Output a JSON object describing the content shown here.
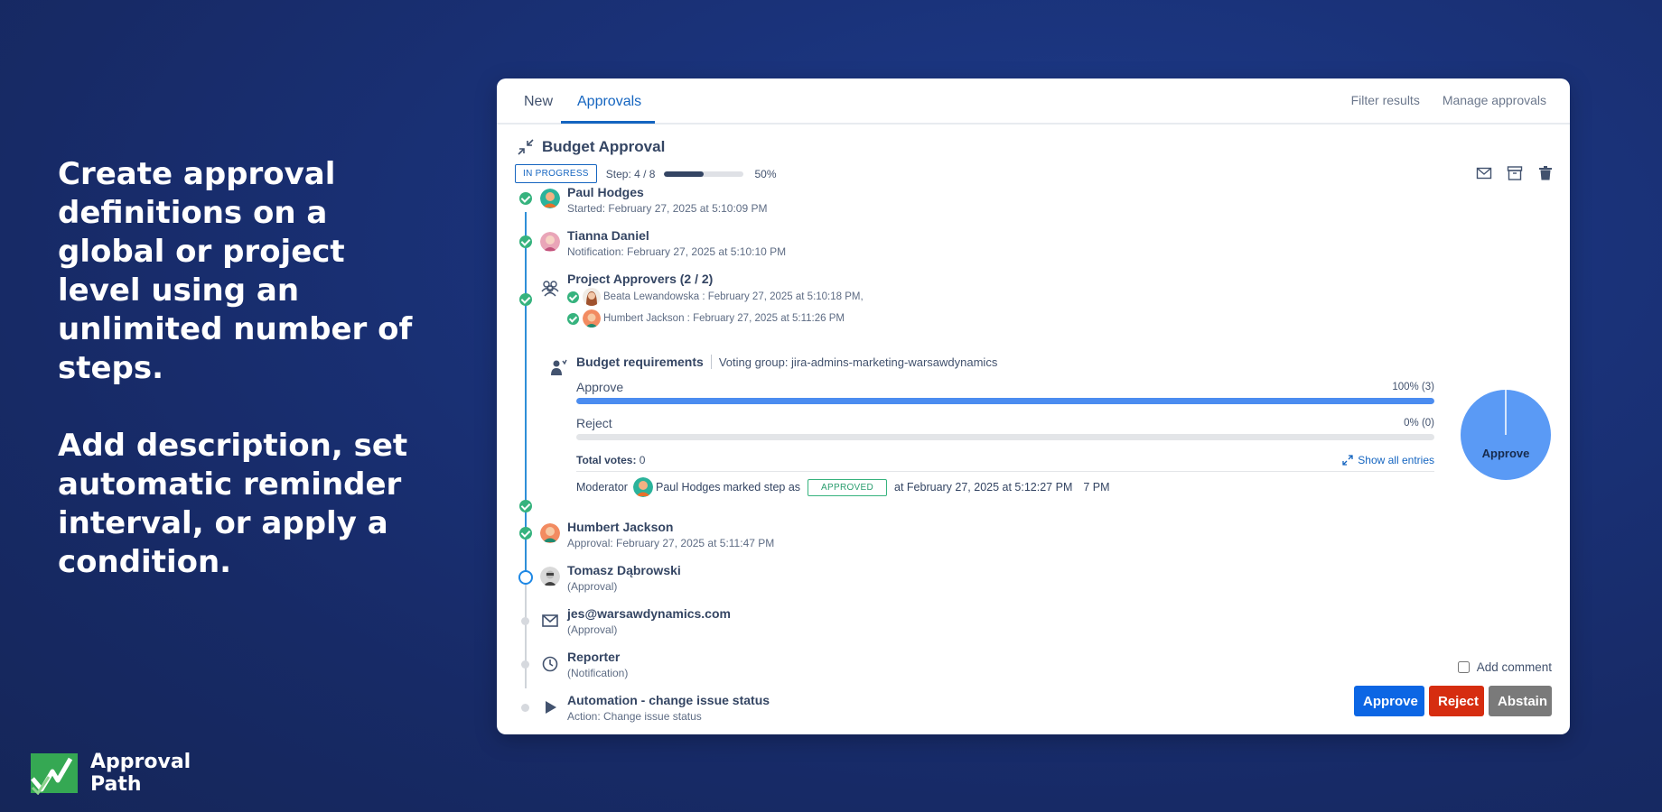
{
  "hero": {
    "paragraph1": "Create approval definitions on a global or project level using an unlimited number of steps.",
    "paragraph2": "Add description, set automatic reminder interval, or apply a condition."
  },
  "brand": {
    "line1": "Approval",
    "line2": "Path"
  },
  "tabs": {
    "new": "New",
    "approvals": "Approvals",
    "filter": "Filter results",
    "manage": "Manage approvals"
  },
  "approval": {
    "title": "Budget Approval",
    "status": "IN PROGRESS",
    "step_text": "Step: 4 / 8",
    "progress_fraction": 0.5,
    "progress_label": "50%"
  },
  "steps": {
    "s1": {
      "name": "Paul Hodges",
      "sub": "Started: February 27, 2025 at 5:10:09 PM"
    },
    "s2": {
      "name": "Tianna Daniel",
      "sub": "Notification: February 27, 2025 at 5:10:10 PM"
    },
    "s3": {
      "name": "Project Approvers (2 / 2)",
      "m1": "Beata Lewandowska : February 27, 2025 at 5:10:18 PM,",
      "m2": "Humbert Jackson : February 27, 2025 at 5:11:26 PM"
    },
    "s5": {
      "name": "Humbert Jackson",
      "sub": "Approval: February 27, 2025 at 5:11:47 PM"
    },
    "s6": {
      "name": "Tomasz Dąbrowski",
      "sub": "(Approval)"
    },
    "s7": {
      "name": "jes@warsawdynamics.com",
      "sub": "(Approval)"
    },
    "s8": {
      "name": "Reporter",
      "sub": "(Notification)"
    },
    "s9": {
      "name": "Automation - change issue status",
      "sub": "Action: Change issue status"
    }
  },
  "vote": {
    "title": "Budget requirements",
    "group": "Voting group: jira-admins-marketing-warsawdynamics",
    "approve_label": "Approve",
    "approve_pct": "100% (3)",
    "approve_fraction": 1.0,
    "reject_label": "Reject",
    "reject_pct": "0% (0)",
    "reject_fraction": 0.0,
    "total_label": "Total votes:",
    "total_value": "0",
    "show_all": "Show all entries",
    "moderator_label": "Moderator",
    "moderator_name": "Paul Hodges",
    "marked_text": "marked step as",
    "approved_badge": "APPROVED",
    "marked_time": "at February 27, 2025 at 5:12:27 PM",
    "marked_tail": "7 PM",
    "pie_label": "Approve"
  },
  "footer": {
    "add_comment": "Add comment",
    "approve_btn": "Approve",
    "reject_btn": "Reject",
    "abstain_btn": "Abstain"
  },
  "colors": {
    "accent": "#1565c0",
    "success": "#36b37e",
    "reject": "#d62d10"
  }
}
